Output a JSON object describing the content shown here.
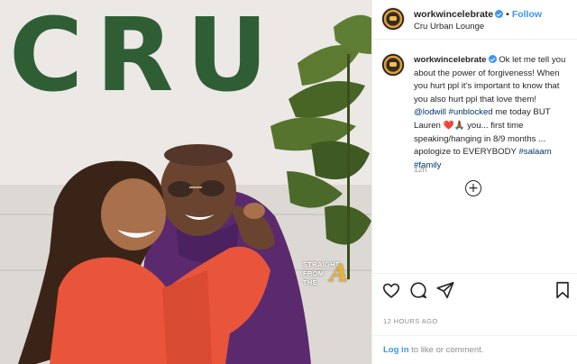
{
  "header": {
    "username": "workwincelebrate",
    "dot": "•",
    "follow_label": "Follow",
    "location": "Cru Urban Lounge"
  },
  "photo": {
    "sign_text": "CRU",
    "watermark": [
      "STRAIGHT",
      "FROM",
      "THE"
    ],
    "watermark_letter": "A"
  },
  "caption": {
    "username": "workwincelebrate",
    "text_1": "Ok let me tell you about the power of forgiveness! When you hurt ppl it’s important to know that you also hurt ppl that love them! ",
    "mention": "@lodwill",
    "text_2": " ",
    "hashtag_1": "#unblocked",
    "text_3": " me today BUT Lauren ❤️🙏🏾 you... first time speaking/hanging in 8/9 months ... apologize to EVERYBODY ",
    "hashtag_2": "#salaam",
    "text_4": " ",
    "hashtag_3": "#family",
    "time": "12h"
  },
  "load_more_icon": "plus-circle-icon",
  "actions": {
    "like_icon": "heart-icon",
    "comment_icon": "comment-icon",
    "share_icon": "share-icon",
    "save_icon": "bookmark-icon"
  },
  "timestamp": "12 HOURS AGO",
  "login": {
    "link": "Log in",
    "text": " to like or comment."
  },
  "colors": {
    "accent": "#3897f0",
    "link": "#00376b",
    "muted": "#8e8e8e",
    "moss": "#2f5e35"
  }
}
